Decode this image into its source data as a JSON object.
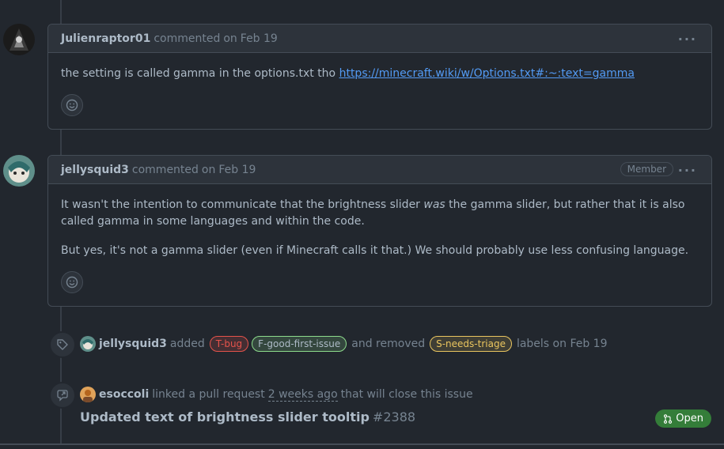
{
  "comments": [
    {
      "author": "Julienraptor01",
      "action": "commented",
      "date_prefix": "on",
      "date": "Feb 19",
      "body_text": "the setting is called gamma in the options.txt tho",
      "link_text": "https://minecraft.wiki/w/Options.txt#:~:text=gamma"
    },
    {
      "author": "jellysquid3",
      "action": "commented",
      "date_prefix": "on",
      "date": "Feb 19",
      "badge": "Member",
      "p1_before": "It wasn't the intention to communicate that the brightness slider",
      "p1_em": "was",
      "p1_after": "the gamma slider, but rather that it is also called gamma in some languages and within the code.",
      "p2": "But yes, it's not a gamma slider (even if Minecraft calls it that.) We should probably use less confusing language."
    }
  ],
  "label_event": {
    "actor": "jellysquid3",
    "added_text": "added",
    "labels_added": [
      {
        "name": "T-bug",
        "color": "#e5534b"
      },
      {
        "name": "F-good-first-issue",
        "color": "#8ddb8c"
      }
    ],
    "removed_text": "and removed",
    "labels_removed": [
      {
        "name": "S-needs-triage",
        "color": "#eac55f"
      }
    ],
    "suffix": "labels on Feb 19"
  },
  "pr_event": {
    "actor": "esoccoli",
    "text1": "linked a pull request",
    "time": "2 weeks ago",
    "text2": "that will close this issue",
    "title": "Updated text of brightness slider tooltip",
    "number": "#2388",
    "status": "Open"
  },
  "icons": {
    "more": "kebab-horizontal-icon",
    "reaction": "smiley-icon",
    "tag": "tag-icon",
    "cross_reference": "cross-reference-icon",
    "pull_request": "git-pull-request-icon"
  },
  "colors": {
    "background": "#22272e",
    "header": "#2d333b",
    "border": "#444c56",
    "link": "#539bf5",
    "open_green": "#347d39"
  }
}
